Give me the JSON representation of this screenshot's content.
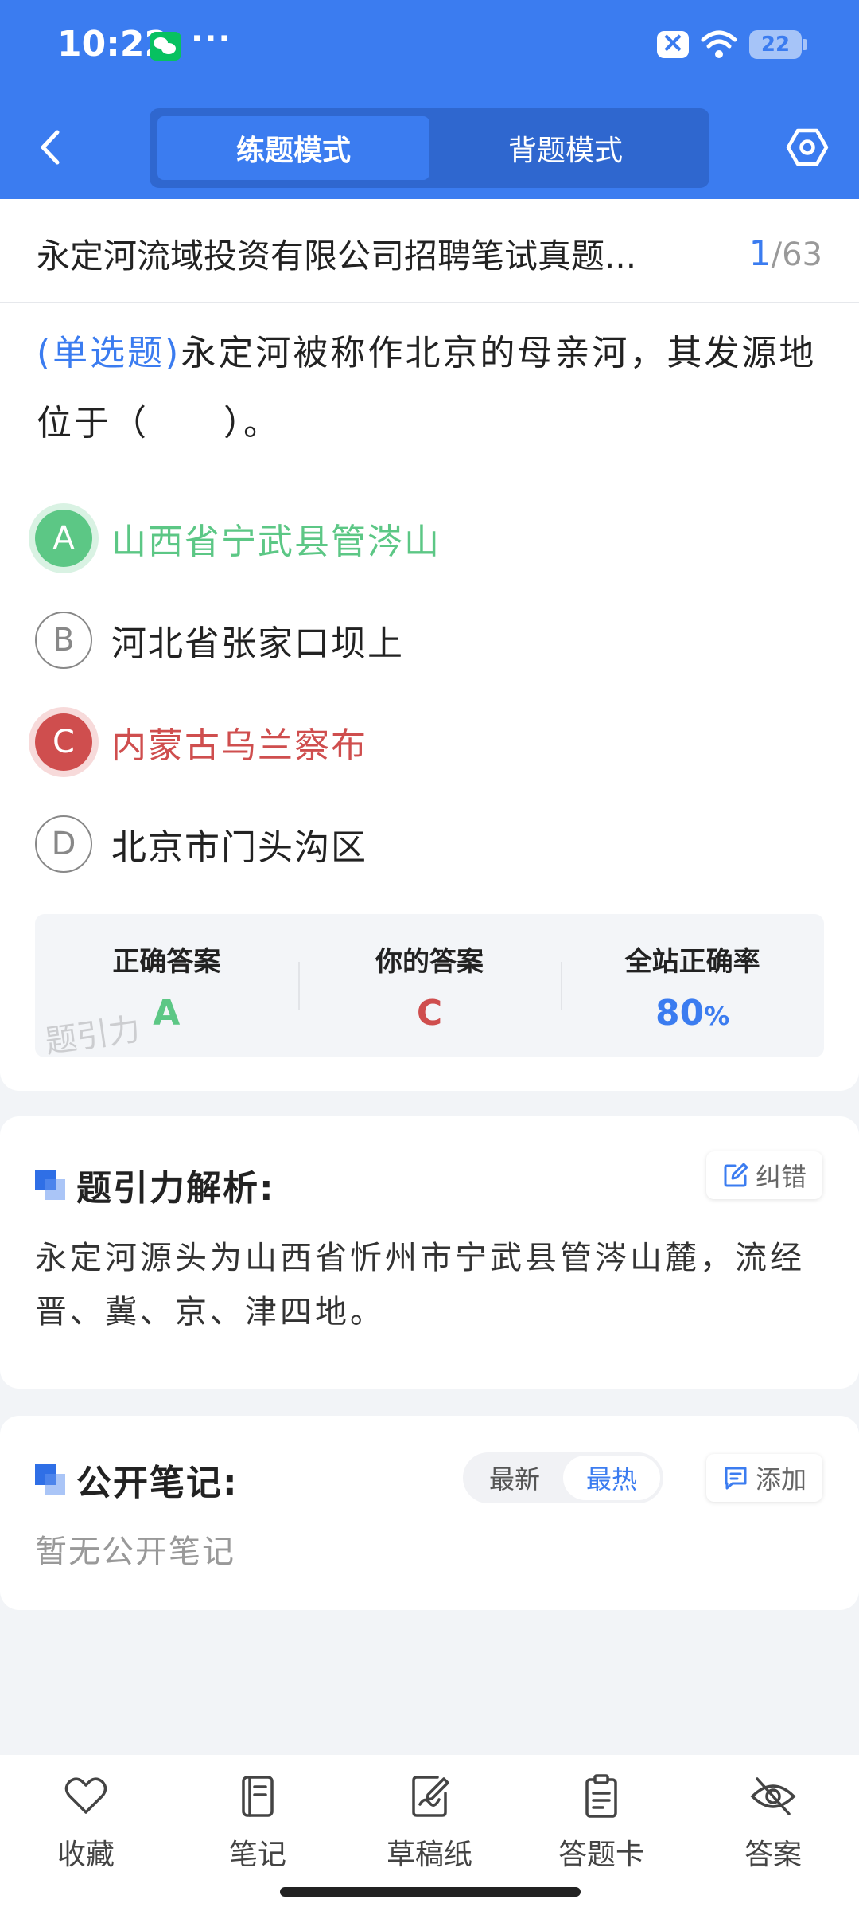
{
  "status_bar": {
    "time": "10:22",
    "dots": "···",
    "battery": "22"
  },
  "header": {
    "tabs": [
      {
        "label": "练题模式",
        "active": true
      },
      {
        "label": "背题模式",
        "active": false
      }
    ],
    "accent_color": "#3b7cf0"
  },
  "paper": {
    "title": "永定河流域投资有限公司招聘笔试真题...",
    "current": "1",
    "separator": "/",
    "total": "63"
  },
  "question": {
    "type": "(单选题)",
    "text": "永定河被称作北京的母亲河，其发源地位于（　　）。"
  },
  "options": [
    {
      "letter": "A",
      "text": "山西省宁武县管涔山",
      "state": "correct"
    },
    {
      "letter": "B",
      "text": "河北省张家口坝上",
      "state": "normal"
    },
    {
      "letter": "C",
      "text": "内蒙古乌兰察布",
      "state": "wrong"
    },
    {
      "letter": "D",
      "text": "北京市门头沟区",
      "state": "normal"
    }
  ],
  "stats": {
    "correct_label": "正确答案",
    "correct_value": "A",
    "yours_label": "你的答案",
    "yours_value": "C",
    "rate_label": "全站正确率",
    "rate_value": "80",
    "rate_unit": "%",
    "watermark": "题引力",
    "colors": {
      "correct": "#5cc785",
      "wrong": "#cf4e4e"
    }
  },
  "analysis": {
    "title": "题引力解析:",
    "report_label": "纠错",
    "text": "永定河源头为山西省忻州市宁武县管涔山麓，流经晋、冀、京、津四地。"
  },
  "notes": {
    "title": "公开笔记:",
    "sort_options": [
      "最新",
      "最热"
    ],
    "active_sort": "最热",
    "add_label": "添加",
    "empty_text": "暂无公开笔记"
  },
  "bottom_bar": [
    {
      "label": "收藏",
      "icon": "heart-icon"
    },
    {
      "label": "笔记",
      "icon": "notebook-icon"
    },
    {
      "label": "草稿纸",
      "icon": "draft-icon"
    },
    {
      "label": "答题卡",
      "icon": "answer-sheet-icon"
    },
    {
      "label": "答案",
      "icon": "eye-off-icon"
    }
  ]
}
